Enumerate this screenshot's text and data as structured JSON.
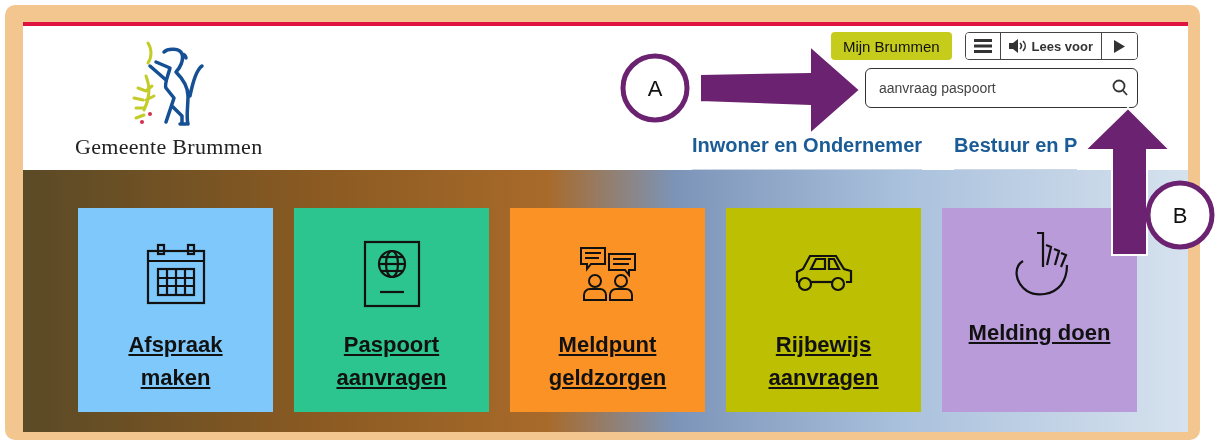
{
  "header": {
    "logo_text": "Gemeente Brummen",
    "account_button": "Mijn Brummen",
    "read_aloud": {
      "label": "Lees voor"
    },
    "search": {
      "value": "aanvraag paspoort"
    },
    "nav": [
      {
        "label": "Inwoner en Ondernemer"
      },
      {
        "label": "Bestuur en P"
      }
    ]
  },
  "tiles": [
    {
      "kind": "calendar",
      "label": "Afspraak\nmaken",
      "color": "#7ec8fb"
    },
    {
      "kind": "passport",
      "label": "Paspoort\naanvragen",
      "color": "#2dc58f"
    },
    {
      "kind": "chat",
      "label": "Meldpunt\ngeldzorgen",
      "color": "#fb9226"
    },
    {
      "kind": "car",
      "label": "Rijbewijs\naanvragen",
      "color": "#bdbf02"
    },
    {
      "kind": "hand",
      "label": "Melding doen",
      "color": "#b99bd9"
    }
  ],
  "callouts": [
    {
      "label": "A",
      "kind": "right"
    },
    {
      "label": "B",
      "kind": "up"
    }
  ]
}
